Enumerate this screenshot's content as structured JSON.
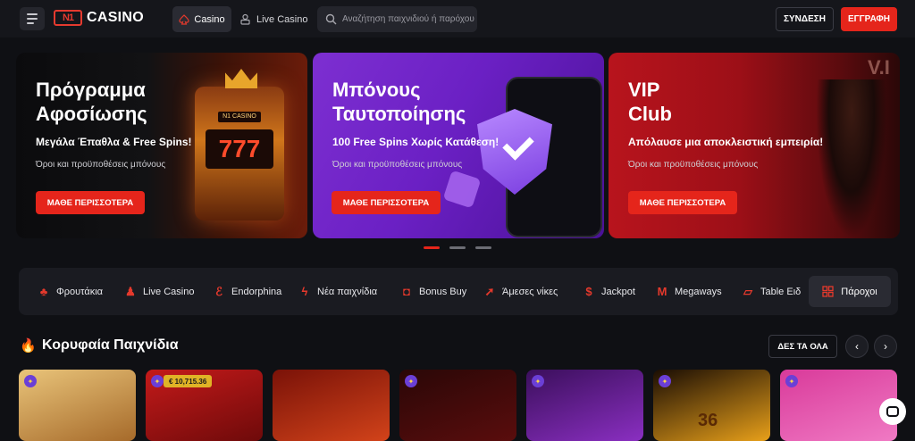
{
  "header": {
    "logo_mark": "N1",
    "logo_word": "CASINO",
    "nav": [
      {
        "label": "Casino",
        "icon": "spade-icon",
        "active": true
      },
      {
        "label": "Live Casino",
        "icon": "dealer-icon",
        "active": false
      }
    ],
    "search_placeholder": "Αναζήτηση παιχνιδιού ή παρόχου",
    "login_label": "ΣΥΝΔΕΣΗ",
    "register_label": "ΕΓΓΡΑΦΗ"
  },
  "banners": [
    {
      "title": "Πρόγραμμα\nΑφοσίωσης",
      "subtitle": "Μεγάλα Έπαθλα & Free Spins!",
      "terms": "Όροι και προϋποθέσεις μπόνους",
      "button": "ΜΑΘΕ ΠΕΡΙΣΣΟΤΕΡΑ",
      "art_reels": "777",
      "art_label": "N1 CASINO"
    },
    {
      "title": "Μπόνους\nΤαυτοποίησης",
      "subtitle": "100 Free Spins Χωρίς Κατάθεση!",
      "terms": "Όροι και προϋποθέσεις μπόνους",
      "button": "ΜΑΘΕ ΠΕΡΙΣΣΟΤΕΡΑ"
    },
    {
      "title": "VIP\nClub",
      "subtitle": "Απόλαυσε μια αποκλειστική εμπειρία!",
      "terms": "Όροι και προϋποθέσεις μπόνους",
      "button": "ΜΑΘΕ ΠΕΡΙΣΣΟΤΕΡΑ",
      "art_sign": "V.I"
    }
  ],
  "carousel": {
    "count": 3,
    "active_index": 0
  },
  "categories": [
    {
      "label": "Φρουτάκια",
      "icon": "cherries-icon"
    },
    {
      "label": "Live Casino",
      "icon": "dealer-icon"
    },
    {
      "label": "Endorphina",
      "icon": "endorphina-icon"
    },
    {
      "label": "Νέα παιχνίδια",
      "icon": "lightning-icon"
    },
    {
      "label": "Bonus Buy",
      "icon": "shopping-bag-icon"
    },
    {
      "label": "Άμεσες νίκες",
      "icon": "rocket-icon"
    },
    {
      "label": "Jackpot",
      "icon": "money-bag-icon"
    },
    {
      "label": "Megaways",
      "icon": "megaways-icon"
    },
    {
      "label": "Table Ειδ",
      "icon": "cards-icon"
    }
  ],
  "providers_label": "Πάροχοι",
  "top_games": {
    "title": "Κορυφαία Παιχνίδια",
    "see_all": "ΔΕΣ ΤΑ ΟΛΑ",
    "jackpot_amount": "€ 10,715.36",
    "card_art_text": "36",
    "cards": [
      {
        "colors": [
          "#e9c47a",
          "#a66a2a"
        ],
        "badge": true
      },
      {
        "colors": [
          "#c41a1a",
          "#6e0a0a"
        ],
        "badge": true
      },
      {
        "colors": [
          "#7a1208",
          "#d2431a"
        ],
        "badge": false
      },
      {
        "colors": [
          "#2a0707",
          "#5a0d0d"
        ],
        "badge": true
      },
      {
        "colors": [
          "#3b0f5c",
          "#8a2fc1"
        ],
        "badge": true
      },
      {
        "colors": [
          "#1a0d04",
          "#e8a01a"
        ],
        "badge": true
      },
      {
        "colors": [
          "#d93a9a",
          "#f07ac4"
        ],
        "badge": true
      }
    ]
  },
  "colors": {
    "accent": "#e5251b",
    "background": "#0f1014",
    "panel": "#1a1b21"
  }
}
